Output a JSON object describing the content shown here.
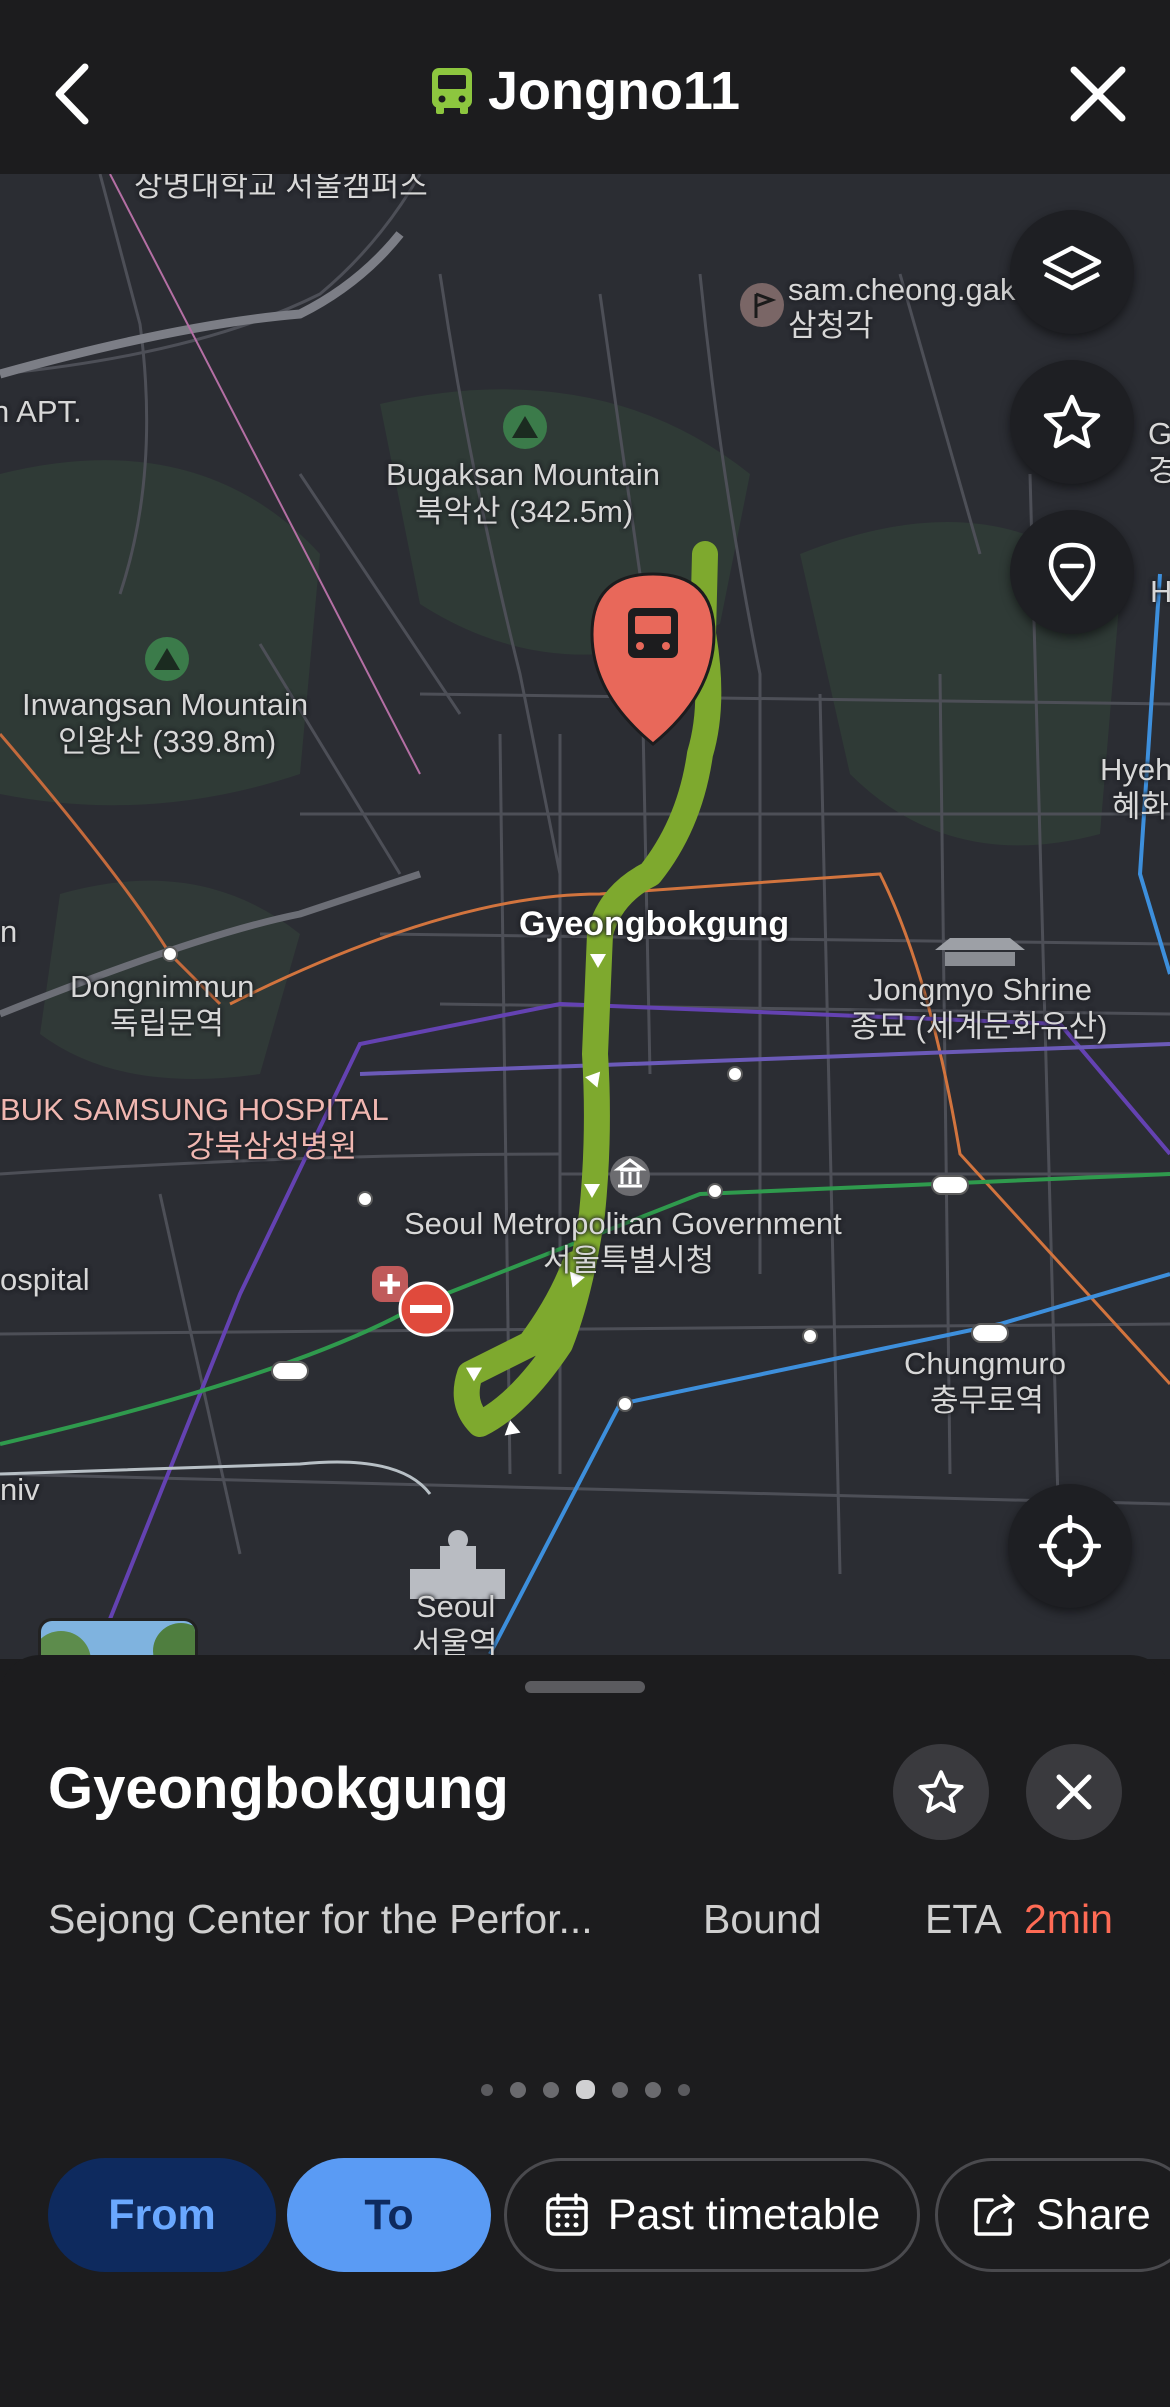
{
  "header": {
    "title": "Jongno11",
    "icons": {
      "back": "chevron-left-icon",
      "bus": "bus-icon",
      "close": "close-icon"
    },
    "bus_color": "#8dc63f"
  },
  "map": {
    "labels": {
      "sangmyung": "상명대학교 서울캠퍼스",
      "samcheong_en": "sam.cheong.gak",
      "samcheong_ko": "삼청각",
      "apt": "n APT.",
      "bugaksan_en": "Bugaksan Mountain",
      "bugaksan_ko": "북악산 (342.5m)",
      "inwangsan_en": "Inwangsan Mountain",
      "inwangsan_ko": "인왕산 (339.8m)",
      "dongnimmun_en": "Dongnimmun",
      "dongnimmun_ko": "독립문역",
      "hospital_en": "BUK SAMSUNG HOSPITAL",
      "hospital_ko": "강북삼성병원",
      "ospital": "ospital",
      "gyeongbokgung": "Gyeongbokgung",
      "jongmyo_en": "Jongmyo Shrine",
      "jongmyo_ko": "종묘 (세계문화유산)",
      "cityhall_en": "Seoul Metropolitan Government",
      "cityhall_ko": "서울특별시청",
      "chungmuro_en": "Chungmuro",
      "chungmuro_ko": "충무로역",
      "seoul_en": "Seoul",
      "seoul_ko": "서울역",
      "hyeh_en": "Hyeh",
      "hyeh_ko": "혜화",
      "edge_g": "G",
      "edge_h": "H",
      "edge_gyeong": "경",
      "edge_n": "n",
      "niv": "niv"
    },
    "scale": {
      "start": "0",
      "end": "500m"
    },
    "route_color": "#8dc63f",
    "stop_pin_color": "#e8685a",
    "buttons": {
      "layers": "layers-icon",
      "favorite": "star-icon",
      "place": "location-pin-icon",
      "locate": "crosshair-icon"
    }
  },
  "sheet": {
    "stop_name": "Gyeongbokgung",
    "direction": "Sejong Center for the Perfor...",
    "bound": "Bound",
    "eta_label": "ETA",
    "eta_value": "2min",
    "eta_color": "#ff6b55",
    "page_dots": 7,
    "active_dot": 4,
    "buttons": {
      "from": "From",
      "to": "To",
      "past_timetable": "Past timetable",
      "share": "Share"
    }
  }
}
